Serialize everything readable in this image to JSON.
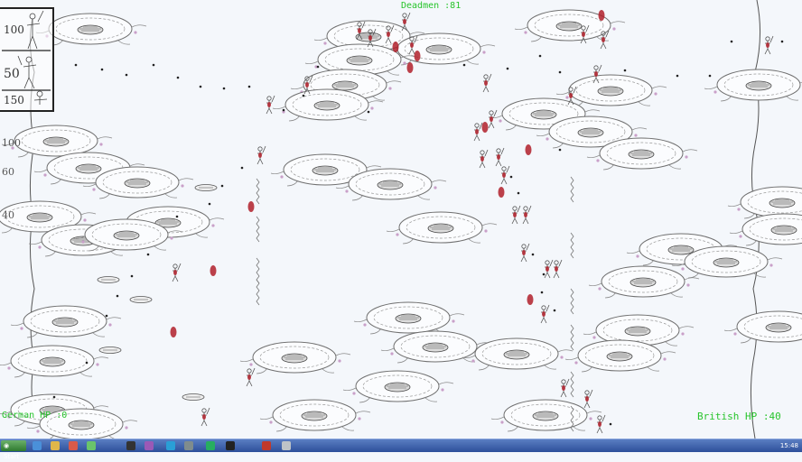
{
  "hud": {
    "dead_men": "Deadmen :81",
    "german_hp": "German HP :0",
    "british_hp": "British HP :40"
  },
  "unit_panel": {
    "costs": [
      "100",
      "50",
      "150"
    ]
  },
  "side_costs": [
    "100",
    "60",
    "40"
  ],
  "taskbar": {
    "start_label": "Start",
    "clock": "15:48"
  },
  "colors": {
    "hud_text": "#27c42b",
    "blood": "#b0202a",
    "taskbar": "#3a5fb0"
  },
  "icons": [
    "start-icon",
    "browser-icon",
    "folder-icon",
    "media-icon",
    "game-icon",
    "settings-icon"
  ]
}
